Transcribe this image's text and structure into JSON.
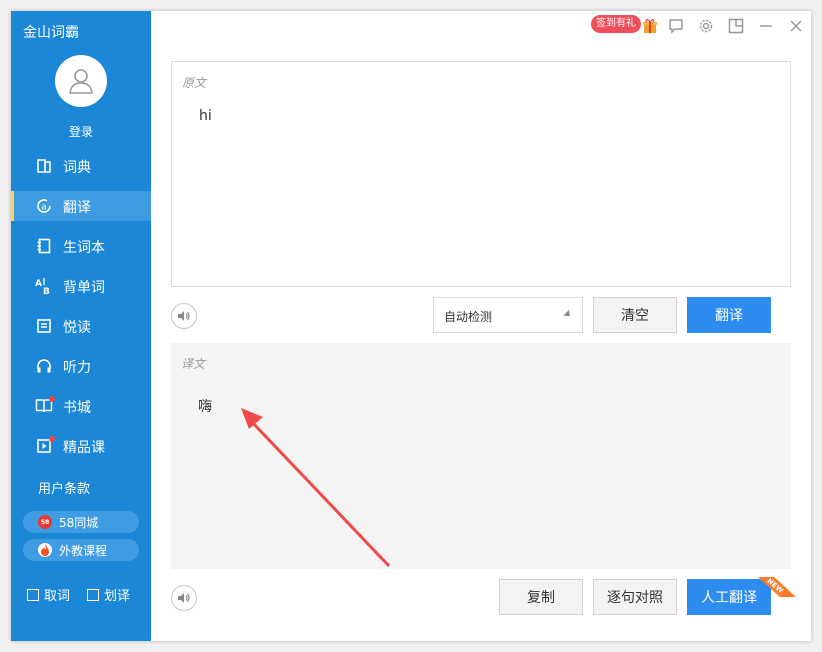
{
  "app": {
    "title": "金山词霸"
  },
  "sidebar": {
    "login": "登录",
    "items": [
      {
        "label": "词典",
        "icon": "dictionary-icon",
        "active": false
      },
      {
        "label": "翻译",
        "icon": "translate-icon",
        "active": true
      },
      {
        "label": "生词本",
        "icon": "wordbook-icon",
        "active": false
      },
      {
        "label": "背单词",
        "icon": "memorize-words-icon",
        "active": false
      },
      {
        "label": "悦读",
        "icon": "reading-icon",
        "active": false
      },
      {
        "label": "听力",
        "icon": "headphones-icon",
        "active": false
      },
      {
        "label": "书城",
        "icon": "bookstore-icon",
        "active": false,
        "dot": true
      },
      {
        "label": "精品课",
        "icon": "course-icon",
        "active": false,
        "dot": true
      }
    ],
    "terms": "用户条款",
    "promos": [
      {
        "label": "58同城",
        "icon": "58-icon",
        "icon_text": "58"
      },
      {
        "label": "外教课程",
        "icon": "flame-icon"
      }
    ],
    "checkboxes": [
      {
        "label": "取词",
        "checked": false
      },
      {
        "label": "划译",
        "checked": false
      }
    ]
  },
  "topbar": {
    "signin_badge": "签到有礼"
  },
  "source": {
    "label": "原文",
    "text": "hi"
  },
  "controls": {
    "language_select": "自动检测",
    "clear_label": "清空",
    "translate_label": "翻译"
  },
  "target": {
    "label": "译文",
    "text": "嗨"
  },
  "actions": {
    "copy_label": "复制",
    "compare_label": "逐句对照",
    "human_translate_label": "人工翻译",
    "new_badge": "NEW"
  },
  "colors": {
    "sidebar": "#1c87d6",
    "accent": "#2d8cf0",
    "annotation_arrow": "#ee4b48",
    "badge": "#ee4f5a"
  }
}
